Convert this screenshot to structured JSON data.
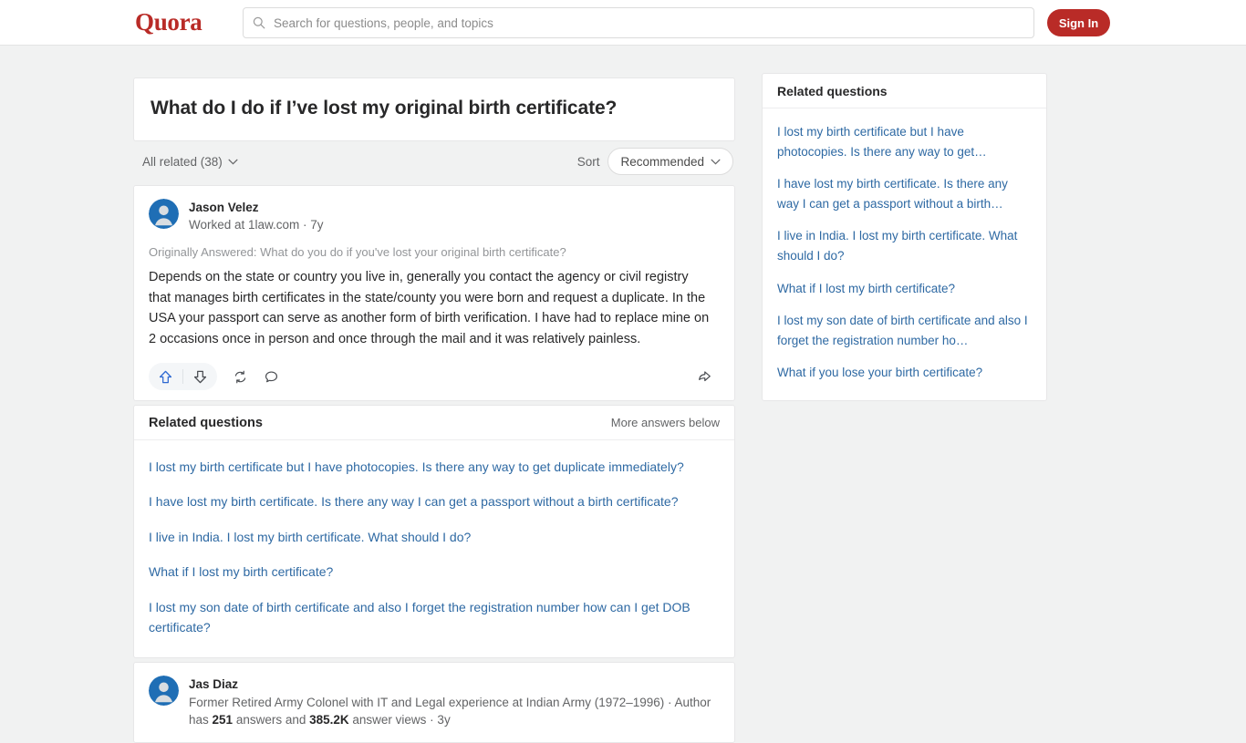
{
  "header": {
    "logo": "Quora",
    "search_placeholder": "Search for questions, people, and topics",
    "search_value": "",
    "search_icon": "search-icon",
    "signin_label": "Sign In"
  },
  "question": {
    "title": "What do I do if I’ve lost my original birth certificate?"
  },
  "filters": {
    "all_related_label": "All related (38)",
    "sort_label": "Sort",
    "sort_value": "Recommended",
    "chevron_icon": "chevron-down-icon"
  },
  "answers": [
    {
      "author_name": "Jason Velez",
      "author_credential": "Worked at 1law.com · 7y",
      "originally_answered": "Originally Answered: What do you do if you've lost your original birth certificate?",
      "body": "Depends on the state or country you live in, generally you contact the agency or civil registry that manages birth certificates in the state/county you were born and request a duplicate. In the USA your passport can serve as another form of birth verification. I have had to replace mine on 2 occasions once in person and once through the mail and it was relatively painless.",
      "actions": {
        "upvote_icon": "upvote-arrow-icon",
        "downvote_icon": "downvote-arrow-icon",
        "repost_icon": "repost-icon",
        "comment_icon": "comment-bubble-icon",
        "share_icon": "share-arrow-icon"
      }
    },
    {
      "author_name": "Jas Diaz",
      "credential_prefix": "Former Retired Army Colonel with IT and Legal experience at Indian Army (1972–1996) · Author has ",
      "answers_count": "251",
      "credential_mid": " answers and ",
      "views_count": "385.2K",
      "credential_suffix": " answer views · 3y"
    }
  ],
  "related_main": {
    "title": "Related questions",
    "more_answers_label": "More answers below",
    "items": [
      "I lost my birth certificate but I have photocopies. Is there any way to get duplicate immediately?",
      "I have lost my birth certificate. Is there any way I can get a passport without a birth certificate?",
      "I live in India. I lost my birth certificate. What should I do?",
      "What if I lost my birth certificate?",
      "I lost my son date of birth certificate and also I forget the registration number how can I get DOB certificate?"
    ]
  },
  "related_sidebar": {
    "title": "Related questions",
    "items": [
      "I lost my birth certificate but I have photocopies. Is there any way to get…",
      "I have lost my birth certificate. Is there any way I can get a passport without a birth…",
      "I live in India. I lost my birth certificate. What should I do?",
      "What if I lost my birth certificate?",
      "I lost my son date of birth certificate and also I forget the registration number ho…",
      "What if you lose your birth certificate?"
    ]
  },
  "colors": {
    "brand_red": "#b92b27",
    "link_blue": "#2e69a3",
    "upvote_blue": "#2e69d2",
    "page_bg": "#f1f2f2",
    "avatar_blue": "#1f6eb5"
  }
}
